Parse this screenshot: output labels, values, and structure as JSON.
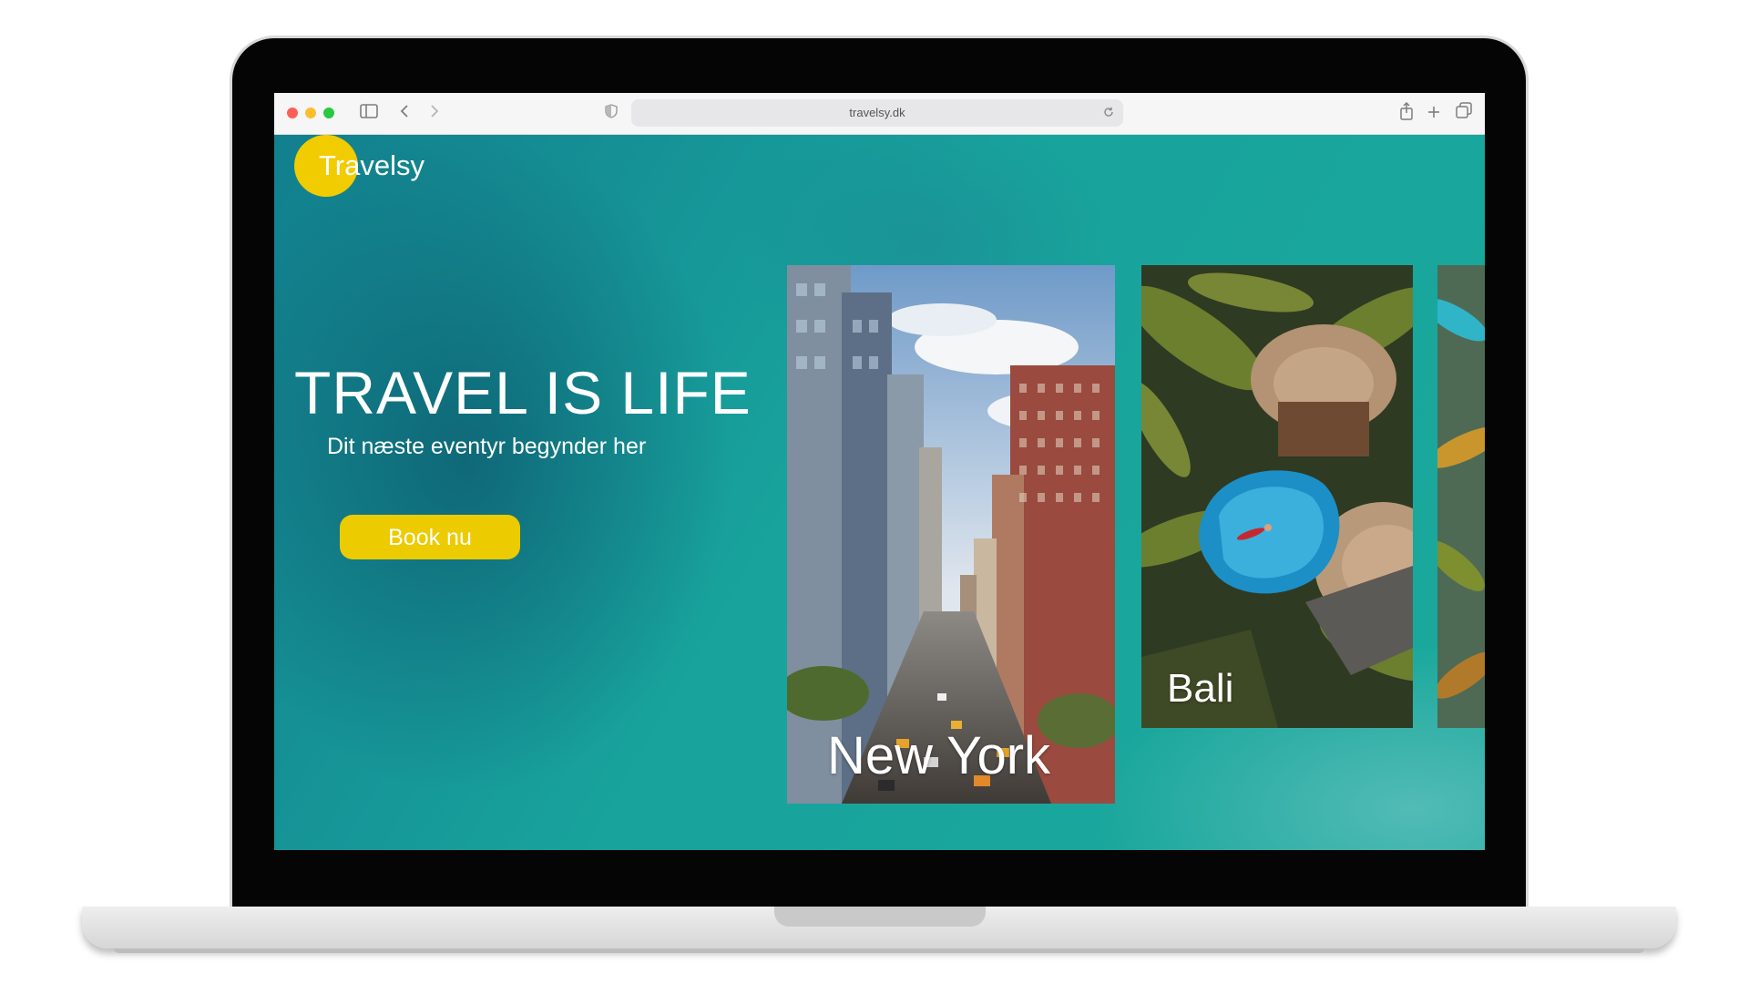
{
  "browser": {
    "url": "travelsy.dk"
  },
  "site": {
    "logo": "Travelsy",
    "hero_title": "TRAVEL IS LIFE",
    "hero_subtitle": "Dit næste eventyr begynder her",
    "cta_label": "Book nu"
  },
  "destinations": [
    {
      "name": "New York"
    },
    {
      "name": "Bali"
    }
  ],
  "colors": {
    "accent": "#eccb00",
    "ocean": "#1aa399"
  }
}
